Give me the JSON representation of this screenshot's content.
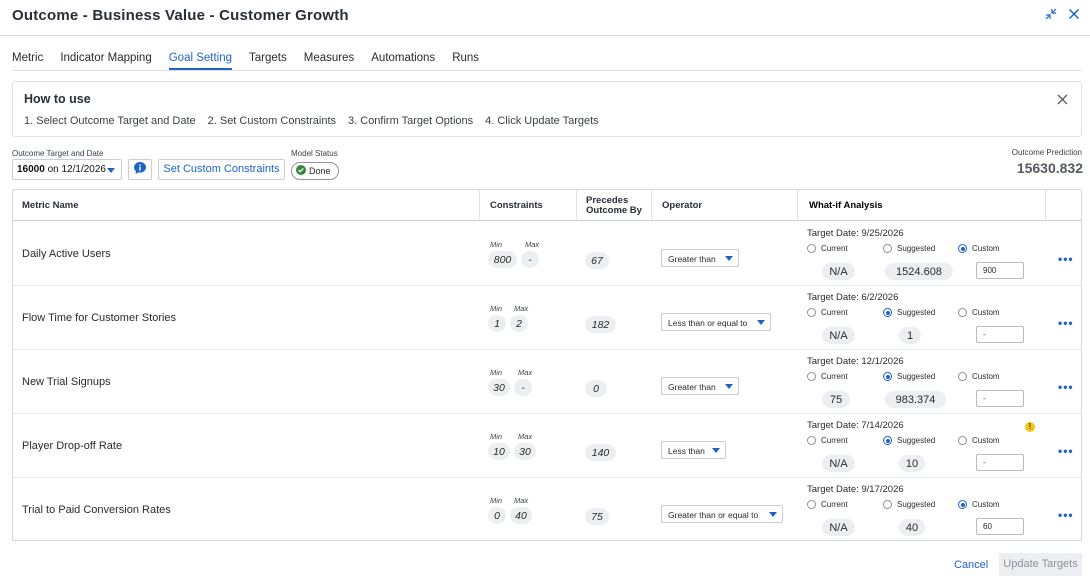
{
  "header": {
    "title": "Outcome  -  Business Value - Customer Growth"
  },
  "tabs": [
    {
      "label": "Metric",
      "active": false
    },
    {
      "label": "Indicator Mapping",
      "active": false
    },
    {
      "label": "Goal Setting",
      "active": true
    },
    {
      "label": "Targets",
      "active": false
    },
    {
      "label": "Measures",
      "active": false
    },
    {
      "label": "Automations",
      "active": false
    },
    {
      "label": "Runs",
      "active": false
    }
  ],
  "howto": {
    "title": "How to use",
    "steps": [
      "1. Select Outcome Target and Date",
      "2. Set Custom Constraints",
      "3. Confirm Target Options",
      "4. Click Update Targets"
    ]
  },
  "controls": {
    "target_label": "Outcome Target and Date",
    "target_value": "16000",
    "target_date_text": " on 12/1/2026",
    "constraints_button": "Set Custom Constraints",
    "model_status_label": "Model Status",
    "model_status_value": "Done",
    "prediction_label": "Outcome Prediction",
    "prediction_value": "15630.832"
  },
  "table": {
    "headers": {
      "metric": "Metric Name",
      "constraints": "Constraints",
      "precedes": "Precedes Outcome By",
      "operator": "Operator",
      "whatif": "What-if Analysis"
    },
    "labels": {
      "min": "Min",
      "max": "Max",
      "current": "Current",
      "suggested": "Suggested",
      "custom": "Custom"
    },
    "rows": [
      {
        "name": "Daily Active Users",
        "min": "800",
        "max": "-",
        "precedes": "67",
        "operator": "Greater than",
        "target_date": "Target Date: 9/25/2026",
        "selected": "custom",
        "current": "N/A",
        "suggested": "1524.608",
        "custom": "900",
        "warning": false
      },
      {
        "name": "Flow Time for Customer Stories",
        "min": "1",
        "max": "2",
        "precedes": "182",
        "operator": "Less than or equal to",
        "target_date": "Target Date: 6/2/2026",
        "selected": "suggested",
        "current": "N/A",
        "suggested": "1",
        "custom": "-",
        "warning": false
      },
      {
        "name": "New Trial Signups",
        "min": "30",
        "max": "-",
        "precedes": "0",
        "operator": "Greater than",
        "target_date": "Target Date: 12/1/2026",
        "selected": "suggested",
        "current": "75",
        "suggested": "983.374",
        "custom": "-",
        "warning": false
      },
      {
        "name": "Player Drop-off Rate",
        "min": "10",
        "max": "30",
        "precedes": "140",
        "operator": "Less than",
        "target_date": "Target Date: 7/14/2026",
        "selected": "suggested",
        "current": "N/A",
        "suggested": "10",
        "custom": "-",
        "warning": true
      },
      {
        "name": "Trial to Paid Conversion Rates",
        "min": "0",
        "max": "40",
        "precedes": "75",
        "operator": "Greater than or equal to",
        "target_date": "Target Date: 9/17/2026",
        "selected": "custom",
        "current": "N/A",
        "suggested": "40",
        "custom": "60",
        "warning": false
      }
    ]
  },
  "footer": {
    "cancel": "Cancel",
    "update": "Update Targets"
  },
  "colors": {
    "accent": "#1f63c9",
    "status_done": "#2e8b3a",
    "warning": "#f0c419"
  }
}
